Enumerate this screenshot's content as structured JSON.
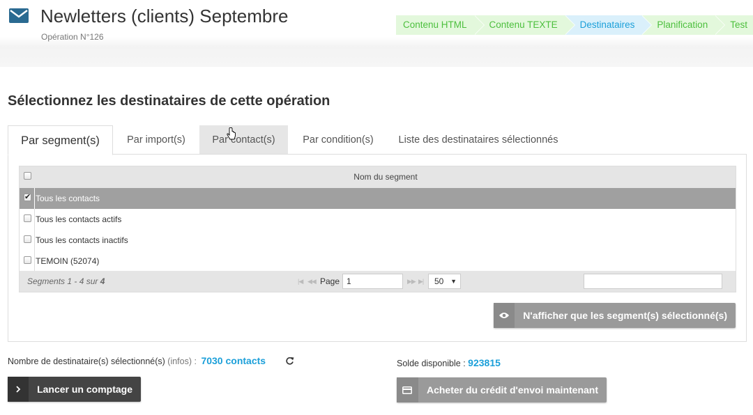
{
  "header": {
    "title": "Newletters (clients) Septembre",
    "operation": "Opération N°126",
    "icon": "envelope-icon",
    "accent": "#2a6a91"
  },
  "steps": [
    {
      "label": "Contenu HTML",
      "state": "done"
    },
    {
      "label": "Contenu TEXTE",
      "state": "done"
    },
    {
      "label": "Destinataires",
      "state": "active"
    },
    {
      "label": "Planification",
      "state": "done"
    },
    {
      "label": "Test",
      "state": "done"
    }
  ],
  "section_title": "Sélectionnez les destinataires de cette opération",
  "tabs": [
    {
      "label": "Par segment(s)"
    },
    {
      "label": "Par import(s)"
    },
    {
      "label": "Par contact(s)"
    },
    {
      "label": "Par condition(s)"
    },
    {
      "label": "Liste des destinataires sélectionnés"
    }
  ],
  "grid": {
    "column": "Nom du segment",
    "rows": [
      {
        "label": "Tous les contacts",
        "checked": true
      },
      {
        "label": "Tous les contacts actifs",
        "checked": false
      },
      {
        "label": "Tous les contacts inactifs",
        "checked": false
      },
      {
        "label": "TEMOIN (52074)",
        "checked": false
      }
    ],
    "pager": {
      "count_prefix": "Segments 1 - 4 sur ",
      "count_total": "4",
      "page_label": "Page",
      "page_value": "1",
      "page_size": "50",
      "first": "|◀",
      "prev": "◀◀",
      "next": "▶▶",
      "last": "▶|"
    }
  },
  "filter_button": "N'afficher que les segment(s) sélectionné(s)",
  "recipients": {
    "label": "Nombre de destinataire(s) sélectionné(s)",
    "infos": "(infos) :",
    "value": "7030 contacts"
  },
  "count_button": "Lancer un comptage",
  "solde": {
    "label": "Solde disponible :",
    "value": "923815"
  },
  "buy_button": "Acheter du crédit d'envoi maintenant",
  "colors": {
    "step_done_bg": "#e3f8dc",
    "step_done_text": "#4cbf3d",
    "step_active_bg": "#daf0fb",
    "step_active_text": "#1b9fd9",
    "value_blue": "#1b9fd9"
  }
}
